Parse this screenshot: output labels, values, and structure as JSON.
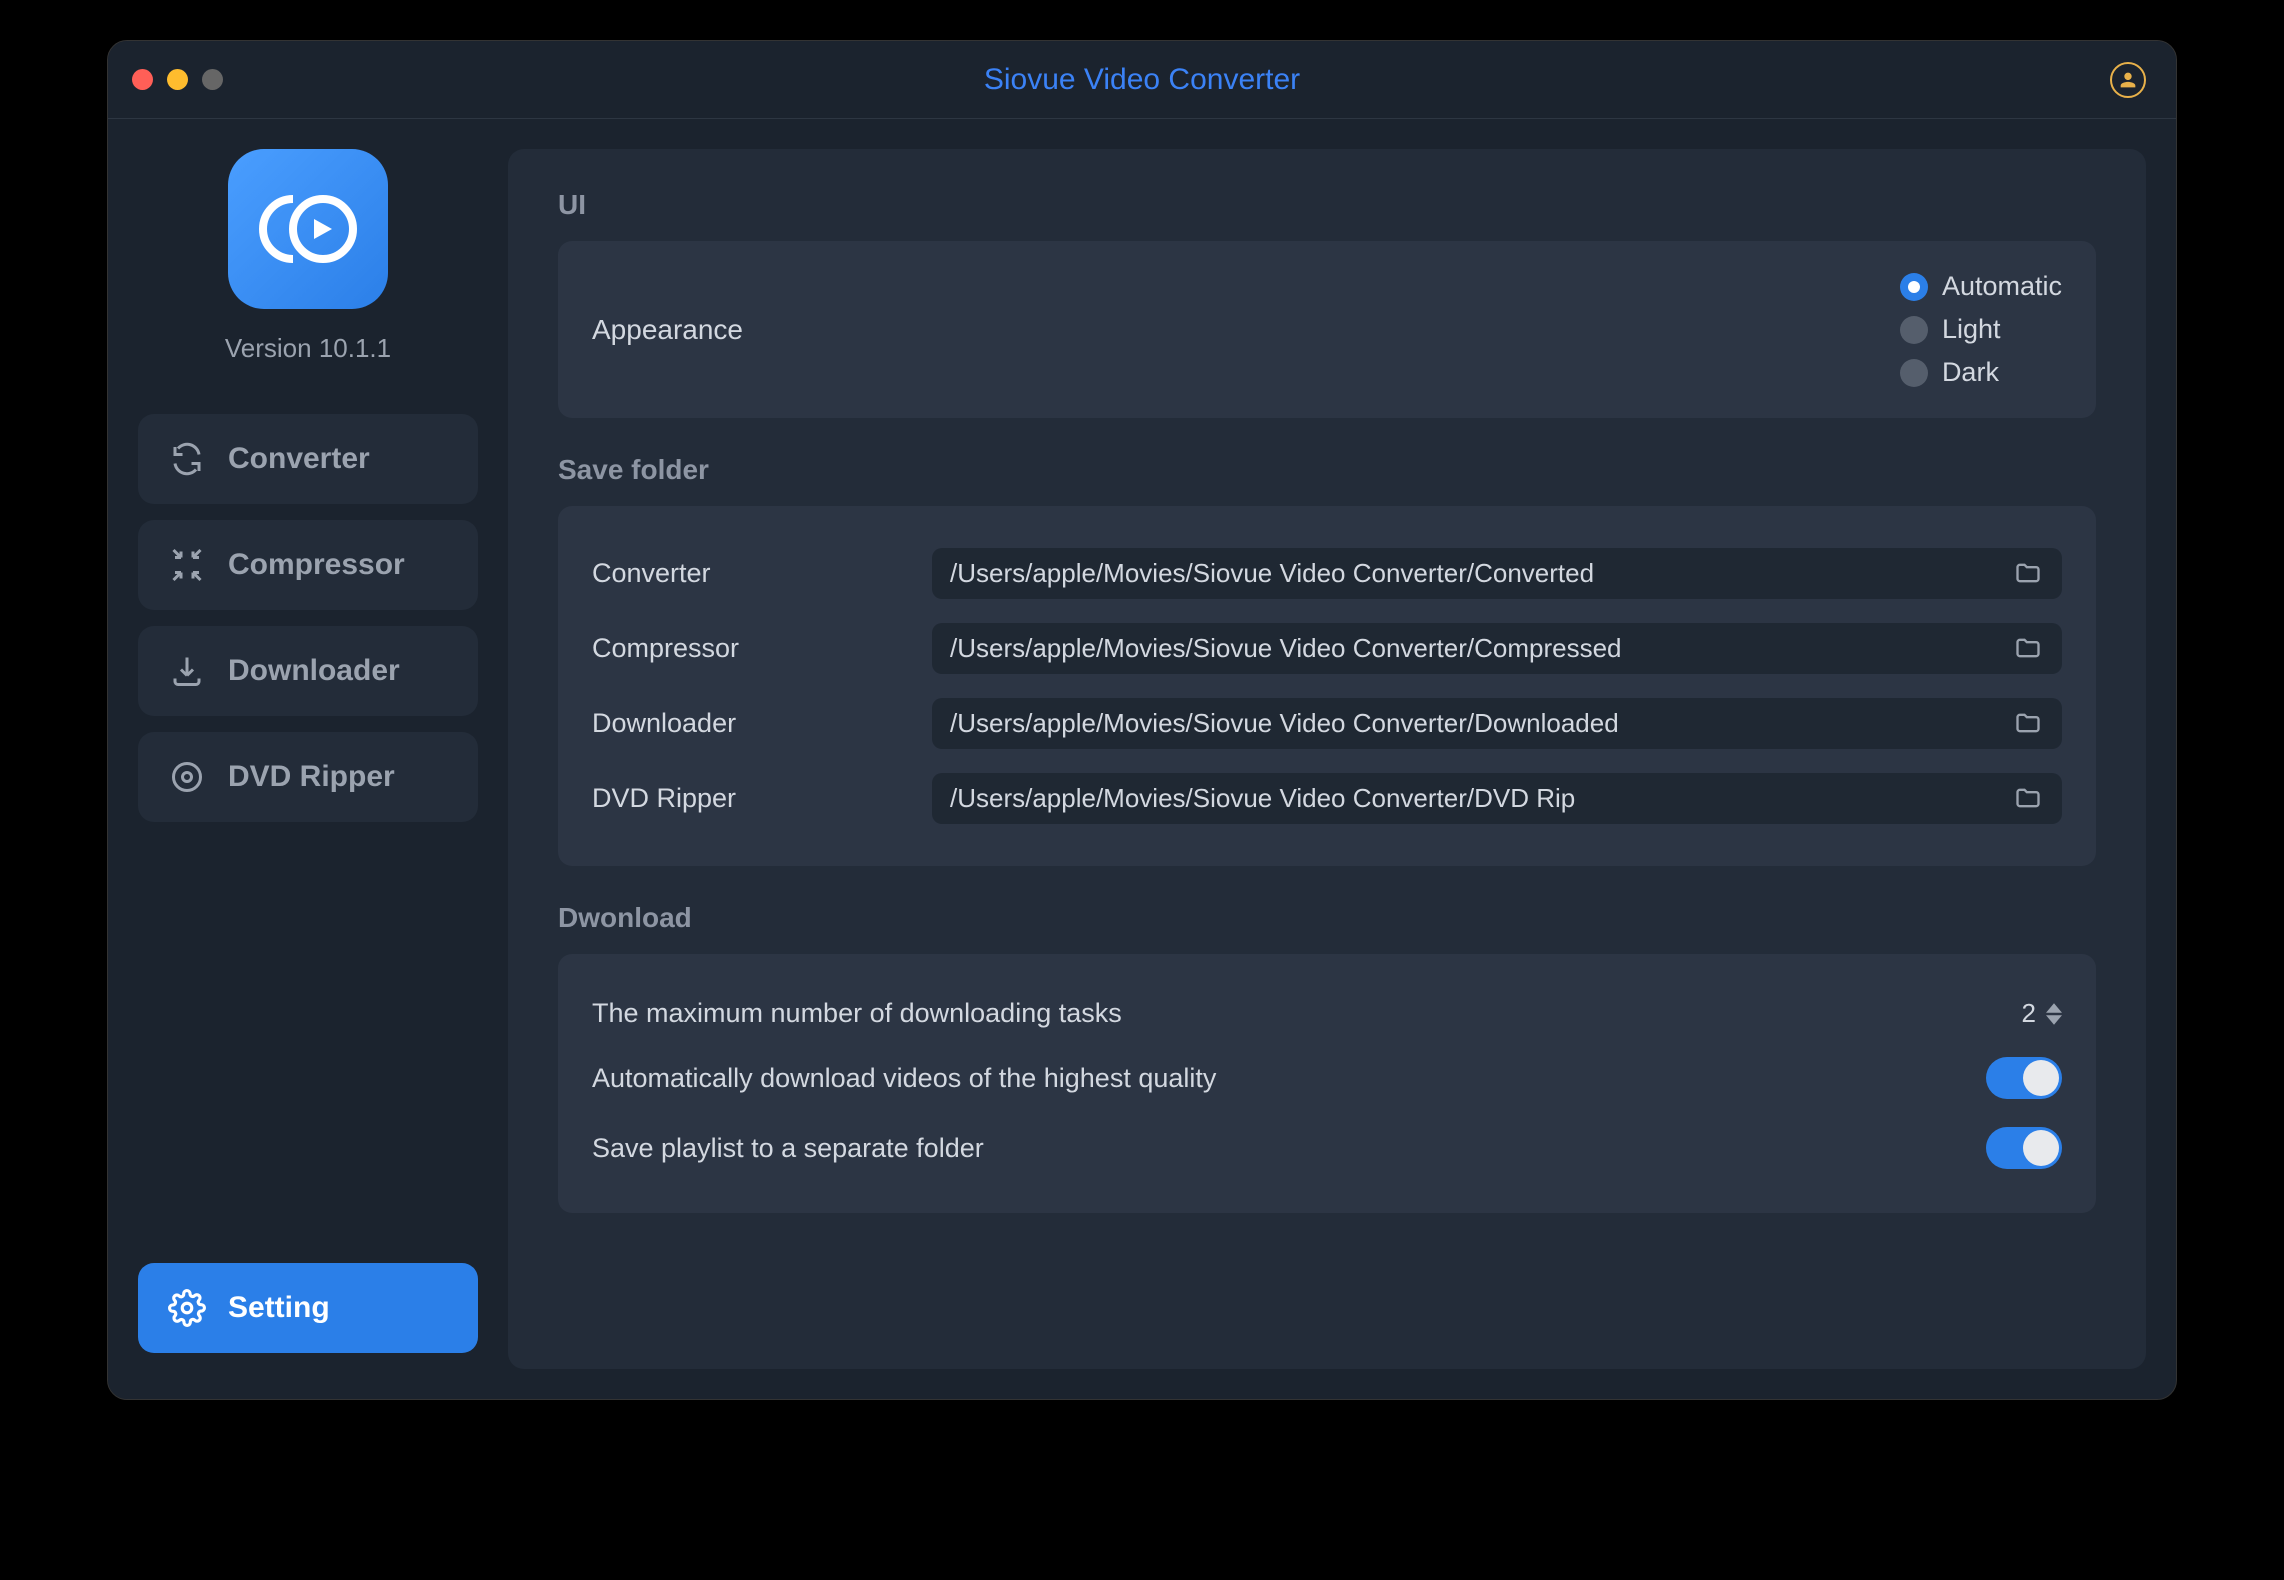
{
  "window": {
    "title": "Siovue Video Converter"
  },
  "sidebar": {
    "version": "Version 10.1.1",
    "nav": [
      {
        "label": "Converter"
      },
      {
        "label": "Compressor"
      },
      {
        "label": "Downloader"
      },
      {
        "label": "DVD Ripper"
      }
    ],
    "setting_label": "Setting"
  },
  "settings": {
    "ui_section": "UI",
    "appearance_label": "Appearance",
    "appearance_options": [
      {
        "label": "Automatic",
        "selected": true
      },
      {
        "label": "Light",
        "selected": false
      },
      {
        "label": "Dark",
        "selected": false
      }
    ],
    "save_folder_section": "Save folder",
    "folders": [
      {
        "label": "Converter",
        "path": "/Users/apple/Movies/Siovue Video Converter/Converted"
      },
      {
        "label": "Compressor",
        "path": "/Users/apple/Movies/Siovue Video Converter/Compressed"
      },
      {
        "label": "Downloader",
        "path": "/Users/apple/Movies/Siovue Video Converter/Downloaded"
      },
      {
        "label": "DVD Ripper",
        "path": "/Users/apple/Movies/Siovue Video Converter/DVD Rip"
      }
    ],
    "download_section": "Dwonload",
    "max_tasks_label": "The maximum number of downloading tasks",
    "max_tasks_value": "2",
    "auto_hq_label": "Automatically download videos of the highest quality",
    "auto_hq_on": true,
    "playlist_folder_label": "Save playlist to a separate folder",
    "playlist_folder_on": true
  }
}
